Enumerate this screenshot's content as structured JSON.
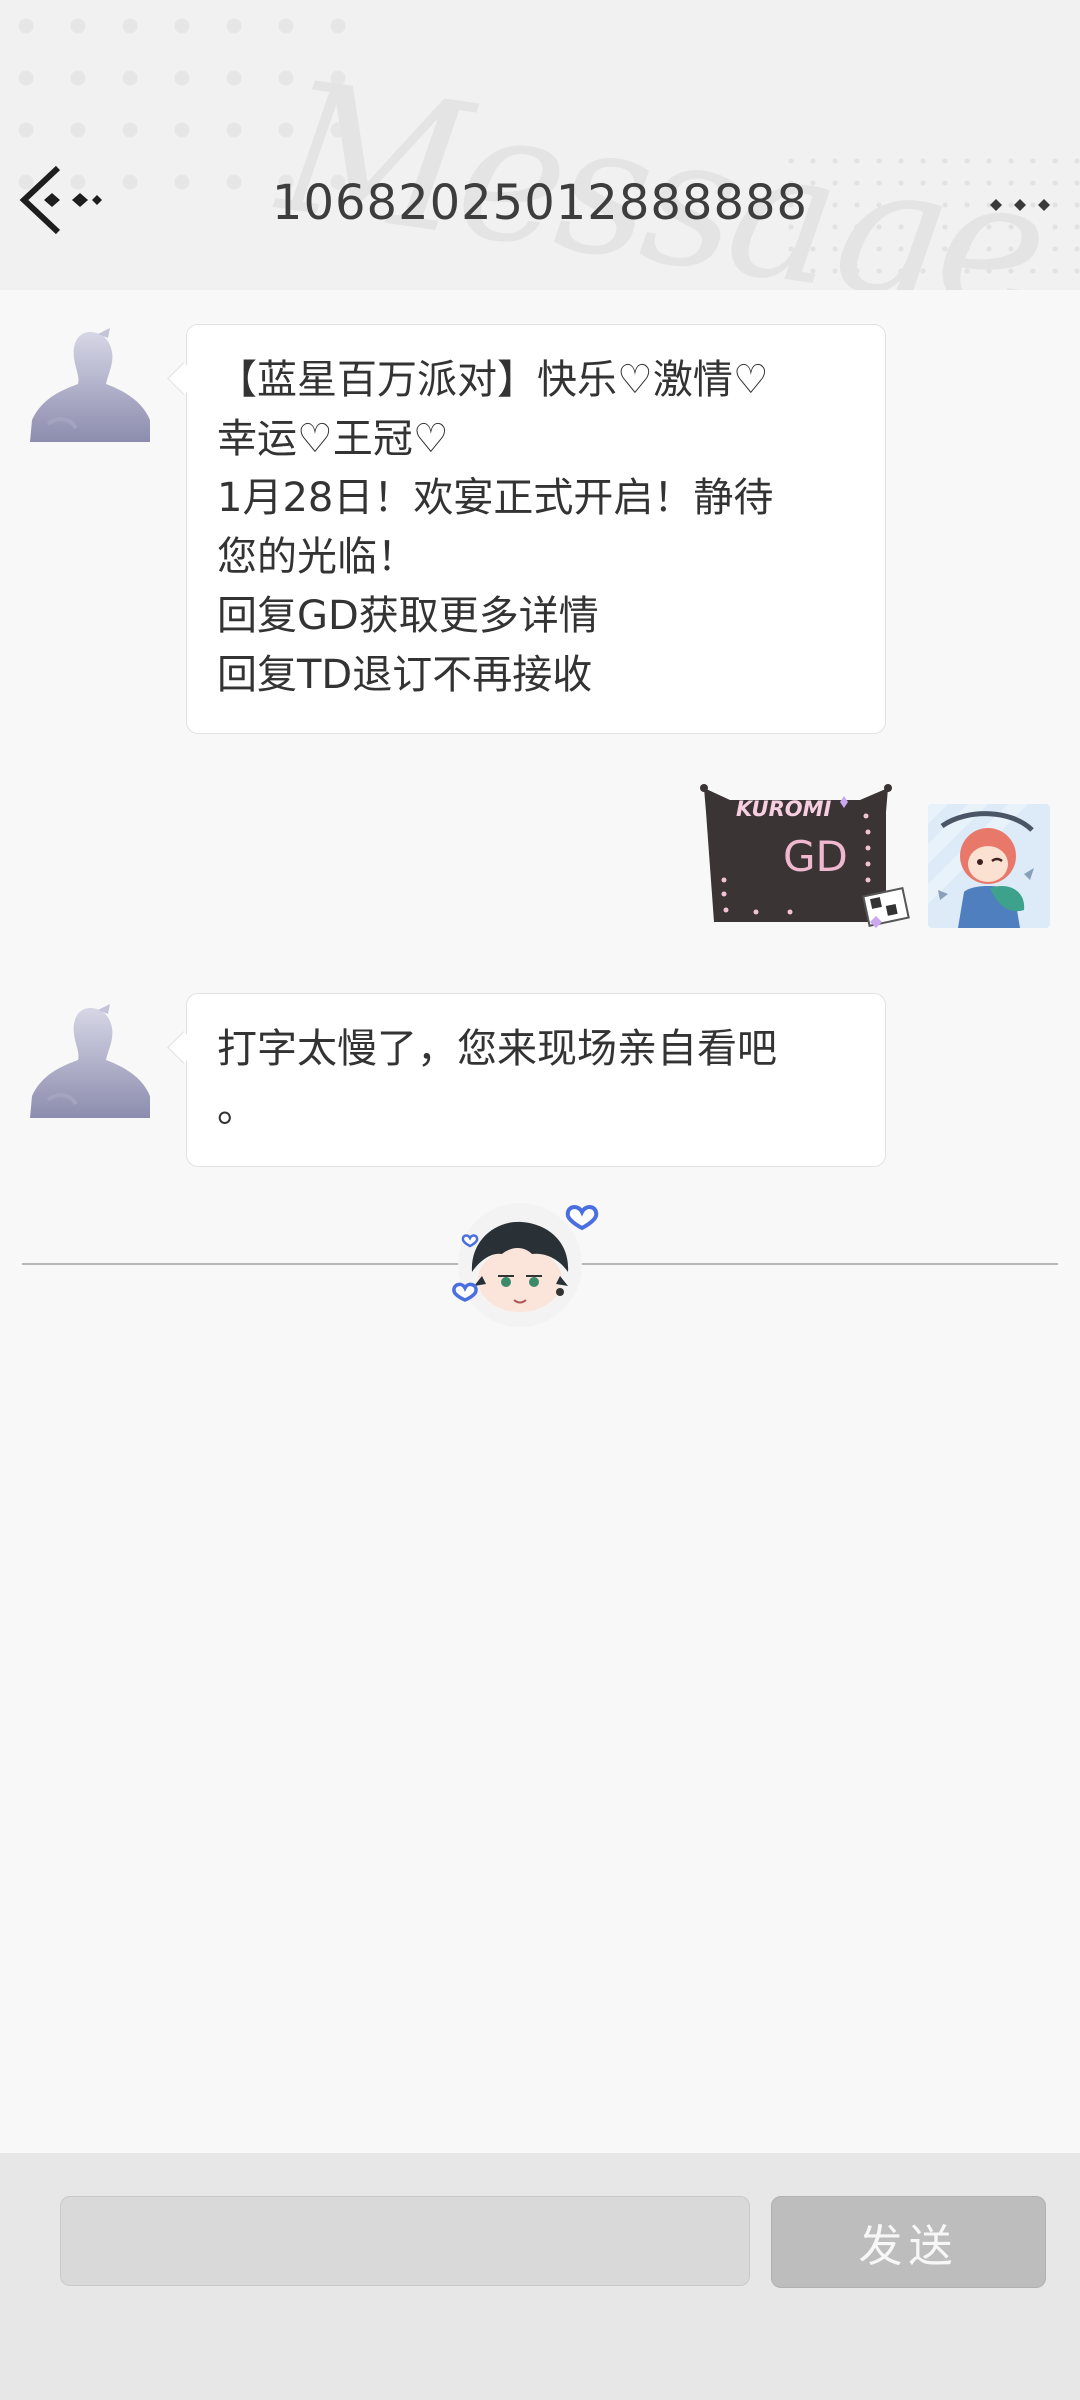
{
  "header": {
    "title": "10682025012888888",
    "watermark": "Message",
    "back_icon": "back-arrow-icon",
    "more_icon": "more-dots-icon"
  },
  "messages": [
    {
      "side": "left",
      "lines": [
        "【蓝星百万派对】快乐♡激情♡",
        "幸运♡王冠♡",
        "1月28日！欢宴正式开启！静待",
        "您的光临！",
        "回复GD获取更多详情",
        "回复TD退订不再接收"
      ]
    },
    {
      "side": "right",
      "sticker_brand": "KUROMI",
      "sticker_text": "GD"
    },
    {
      "side": "left",
      "lines": [
        "打字太慢了，您来现场亲自看吧",
        "。"
      ]
    }
  ],
  "footer": {
    "input_value": "",
    "send_label": "发送"
  },
  "colors": {
    "header_bg": "#f1f1f1",
    "page_bg": "#f8f8f8",
    "bubble_bg": "#ffffff",
    "send_button": "#bdbdbd",
    "heart_accent": "#4a6fe0"
  }
}
